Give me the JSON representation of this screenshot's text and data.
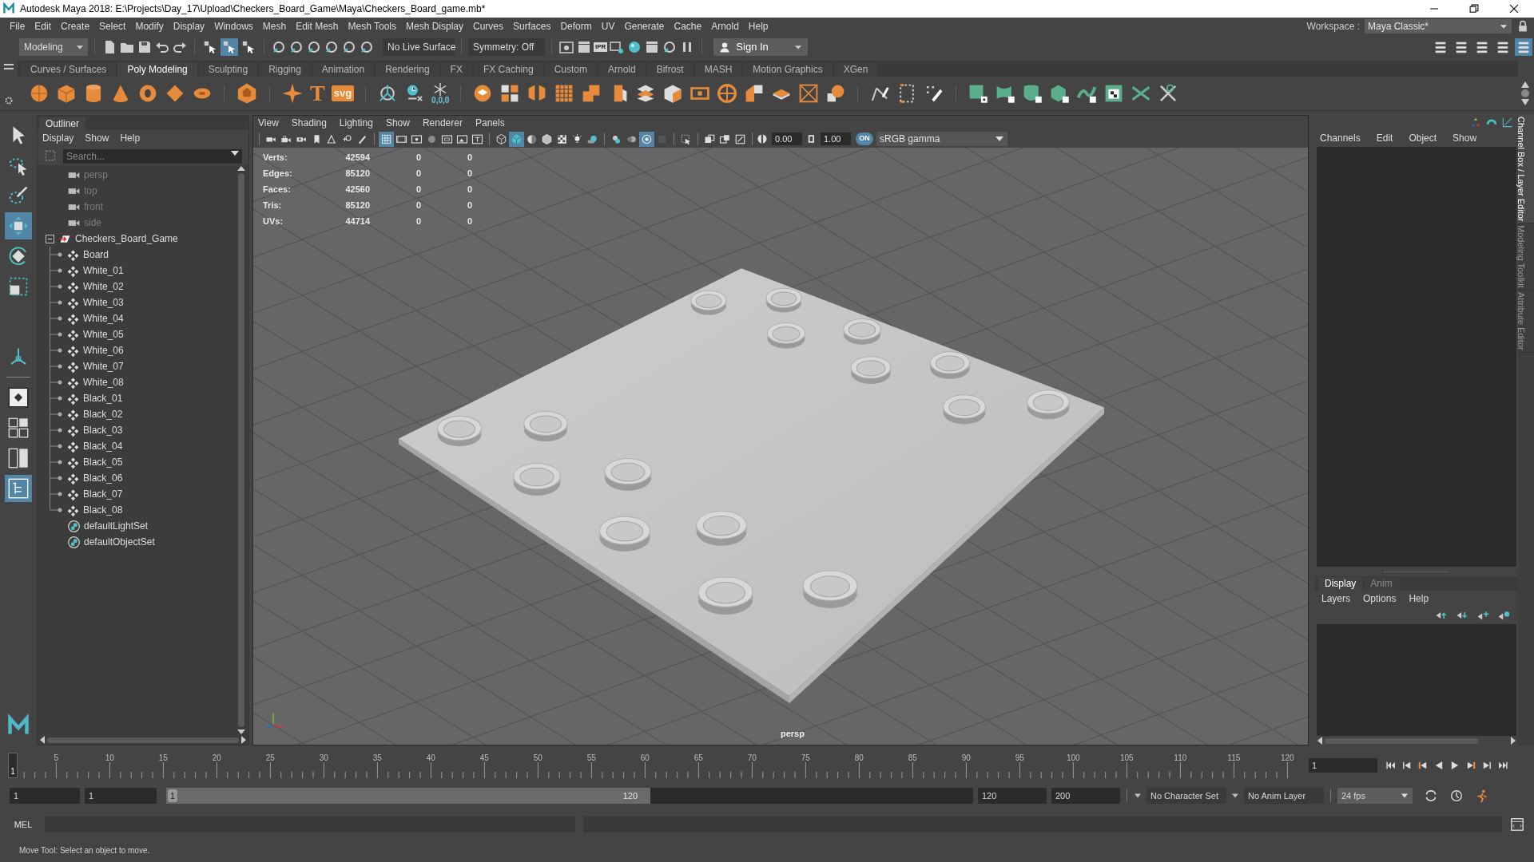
{
  "window": {
    "title": "Autodesk Maya 2018: E:\\Projects\\Day_17\\Upload\\Checkers_Board_Game\\Maya\\Checkers_Board_game.mb*"
  },
  "menu_bar": [
    "File",
    "Edit",
    "Create",
    "Select",
    "Modify",
    "Display",
    "Windows",
    "Mesh",
    "Edit Mesh",
    "Mesh Tools",
    "Mesh Display",
    "Curves",
    "Surfaces",
    "Deform",
    "UV",
    "Generate",
    "Cache",
    "Arnold",
    "Help"
  ],
  "workspace": {
    "label": "Workspace :",
    "value": "Maya Classic*"
  },
  "status_line": {
    "mode": "Modeling",
    "select_modes": [
      {
        "selected": false
      },
      {
        "selected": true
      },
      {
        "selected": false
      }
    ],
    "live_surface": "No Live Surface",
    "symmetry": "Symmetry: Off",
    "ipr": "IPR",
    "sign_in": "Sign In",
    "panel_toggles": [
      {
        "selected": false
      },
      {
        "selected": false
      },
      {
        "selected": false
      },
      {
        "selected": false
      },
      {
        "selected": true
      }
    ]
  },
  "shelf": {
    "tabs": [
      {
        "label": "Curves / Surfaces",
        "selected": false
      },
      {
        "label": "Poly Modeling",
        "selected": true
      },
      {
        "label": "Sculpting",
        "selected": false
      },
      {
        "label": "Rigging",
        "selected": false
      },
      {
        "label": "Animation",
        "selected": false
      },
      {
        "label": "Rendering",
        "selected": false
      },
      {
        "label": "FX",
        "selected": false
      },
      {
        "label": "FX Caching",
        "selected": false
      },
      {
        "label": "Custom",
        "selected": false
      },
      {
        "label": "Arnold",
        "selected": false
      },
      {
        "label": "Bifrost",
        "selected": false
      },
      {
        "label": "MASH",
        "selected": false
      },
      {
        "label": "Motion Graphics",
        "selected": false
      },
      {
        "label": "XGen",
        "selected": false
      }
    ],
    "text_tool": "T",
    "svg_tool": "svg",
    "freeze_caption": "0,0,0"
  },
  "toolbox": [
    {
      "kind": "select",
      "selected": false
    },
    {
      "kind": "lasso",
      "selected": false
    },
    {
      "kind": "paint",
      "selected": false
    },
    {
      "kind": "move",
      "selected": true
    },
    {
      "kind": "rotate",
      "selected": false
    },
    {
      "kind": "scale",
      "selected": false
    },
    {
      "kind": "manip",
      "selected": false
    }
  ],
  "layouts": [
    {
      "kind": "single",
      "selected": false
    },
    {
      "kind": "four",
      "selected": false
    },
    {
      "kind": "two",
      "selected": false
    },
    {
      "kind": "outliner",
      "selected": true
    }
  ],
  "outliner": {
    "title": "Outliner",
    "menus": [
      "Display",
      "Show",
      "Help"
    ],
    "placeholder": "Search...",
    "items": [
      {
        "label": "persp",
        "kind": "camera"
      },
      {
        "label": "top",
        "kind": "camera"
      },
      {
        "label": "front",
        "kind": "camera"
      },
      {
        "label": "side",
        "kind": "camera"
      },
      {
        "label": "Checkers_Board_Game",
        "kind": "group",
        "expanded": true,
        "children": [
          {
            "label": "Board",
            "kind": "mesh"
          },
          {
            "label": "White_01",
            "kind": "mesh"
          },
          {
            "label": "White_02",
            "kind": "mesh"
          },
          {
            "label": "White_03",
            "kind": "mesh"
          },
          {
            "label": "White_04",
            "kind": "mesh"
          },
          {
            "label": "White_05",
            "kind": "mesh"
          },
          {
            "label": "White_06",
            "kind": "mesh"
          },
          {
            "label": "White_07",
            "kind": "mesh"
          },
          {
            "label": "White_08",
            "kind": "mesh"
          },
          {
            "label": "Black_01",
            "kind": "mesh"
          },
          {
            "label": "Black_02",
            "kind": "mesh"
          },
          {
            "label": "Black_03",
            "kind": "mesh"
          },
          {
            "label": "Black_04",
            "kind": "mesh"
          },
          {
            "label": "Black_05",
            "kind": "mesh"
          },
          {
            "label": "Black_06",
            "kind": "mesh"
          },
          {
            "label": "Black_07",
            "kind": "mesh"
          },
          {
            "label": "Black_08",
            "kind": "mesh"
          }
        ]
      },
      {
        "label": "defaultLightSet",
        "kind": "set"
      },
      {
        "label": "defaultObjectSet",
        "kind": "set"
      }
    ]
  },
  "viewport": {
    "menus": [
      "View",
      "Shading",
      "Lighting",
      "Show",
      "Renderer",
      "Panels"
    ],
    "tool_groups": [
      [
        {
          "kind": "camera",
          "selected": false
        },
        {
          "kind": "camera-lock",
          "selected": false
        },
        {
          "kind": "camera-attr",
          "selected": false
        },
        {
          "kind": "bookmark",
          "selected": false
        },
        {
          "kind": "image-plane",
          "selected": false
        },
        {
          "kind": "pan-zoom",
          "selected": false
        },
        {
          "kind": "pencil",
          "selected": false
        }
      ],
      [
        {
          "kind": "grid",
          "selected": true
        },
        {
          "kind": "film-gate",
          "selected": false
        },
        {
          "kind": "resolution-gate",
          "selected": false
        },
        {
          "kind": "gate-mask",
          "selected": false
        },
        {
          "kind": "field-chart",
          "selected": false
        },
        {
          "kind": "safe-action",
          "selected": false
        },
        {
          "kind": "safe-title",
          "selected": false
        }
      ],
      [
        {
          "kind": "wireframe",
          "selected": false
        },
        {
          "kind": "shaded",
          "selected": true
        },
        {
          "kind": "material",
          "selected": false
        },
        {
          "kind": "wire-on-shaded",
          "selected": false
        },
        {
          "kind": "textured",
          "selected": false
        },
        {
          "kind": "light",
          "selected": false
        },
        {
          "kind": "shadow",
          "selected": false
        }
      ],
      [
        {
          "kind": "ambient-occlusion",
          "selected": false
        },
        {
          "kind": "motion-blur",
          "selected": false
        },
        {
          "kind": "antialias",
          "selected": true
        },
        {
          "kind": "depth-of-field",
          "selected": false
        }
      ],
      [
        {
          "kind": "isolate",
          "selected": false
        }
      ],
      [
        {
          "kind": "xray",
          "selected": false
        },
        {
          "kind": "xray-components",
          "selected": false
        },
        {
          "kind": "xray-joints",
          "selected": false
        }
      ]
    ],
    "exposure": "0.00",
    "gamma": "1.00",
    "color_management": "ON",
    "color_space": "sRGB gamma",
    "stats": [
      {
        "label": "Verts:",
        "values": [
          "42594",
          "0",
          "0"
        ]
      },
      {
        "label": "Edges:",
        "values": [
          "85120",
          "0",
          "0"
        ]
      },
      {
        "label": "Faces:",
        "values": [
          "42560",
          "0",
          "0"
        ]
      },
      {
        "label": "Tris:",
        "values": [
          "85120",
          "0",
          "0"
        ]
      },
      {
        "label": "UVs:",
        "values": [
          "44714",
          "0",
          "0"
        ]
      }
    ],
    "camera_label": "persp"
  },
  "channel_box": {
    "menus": [
      "Channels",
      "Edit",
      "Object",
      "Show"
    ]
  },
  "layer_editor": {
    "tabs": [
      {
        "label": "Display",
        "selected": true
      },
      {
        "label": "Anim",
        "selected": false
      }
    ],
    "menus": [
      "Layers",
      "Options",
      "Help"
    ]
  },
  "side_tabs": [
    {
      "label": "Channel Box / Layer Editor",
      "selected": true
    },
    {
      "label": "Modeling Toolkit",
      "selected": false
    },
    {
      "label": "Attribute Editor",
      "selected": false
    }
  ],
  "time_slider": {
    "current_frame": "1",
    "ticks": [
      "5",
      "10",
      "15",
      "20",
      "25",
      "30",
      "35",
      "40",
      "45",
      "50",
      "55",
      "60",
      "65",
      "70",
      "75",
      "80",
      "85",
      "90",
      "95",
      "100",
      "105",
      "110",
      "115",
      "120"
    ],
    "frame_field": "1"
  },
  "range_slider": {
    "start": "1",
    "playback_start": "1",
    "handle_start": "1",
    "handle_end": "120",
    "level": 0.6,
    "playback_end": "120",
    "end": "200",
    "character_set": "No Character Set",
    "anim_layer": "No Anim Layer",
    "fps": "24 fps"
  },
  "command_line": {
    "language": "MEL"
  },
  "help_line": "Move Tool: Select an object to move."
}
